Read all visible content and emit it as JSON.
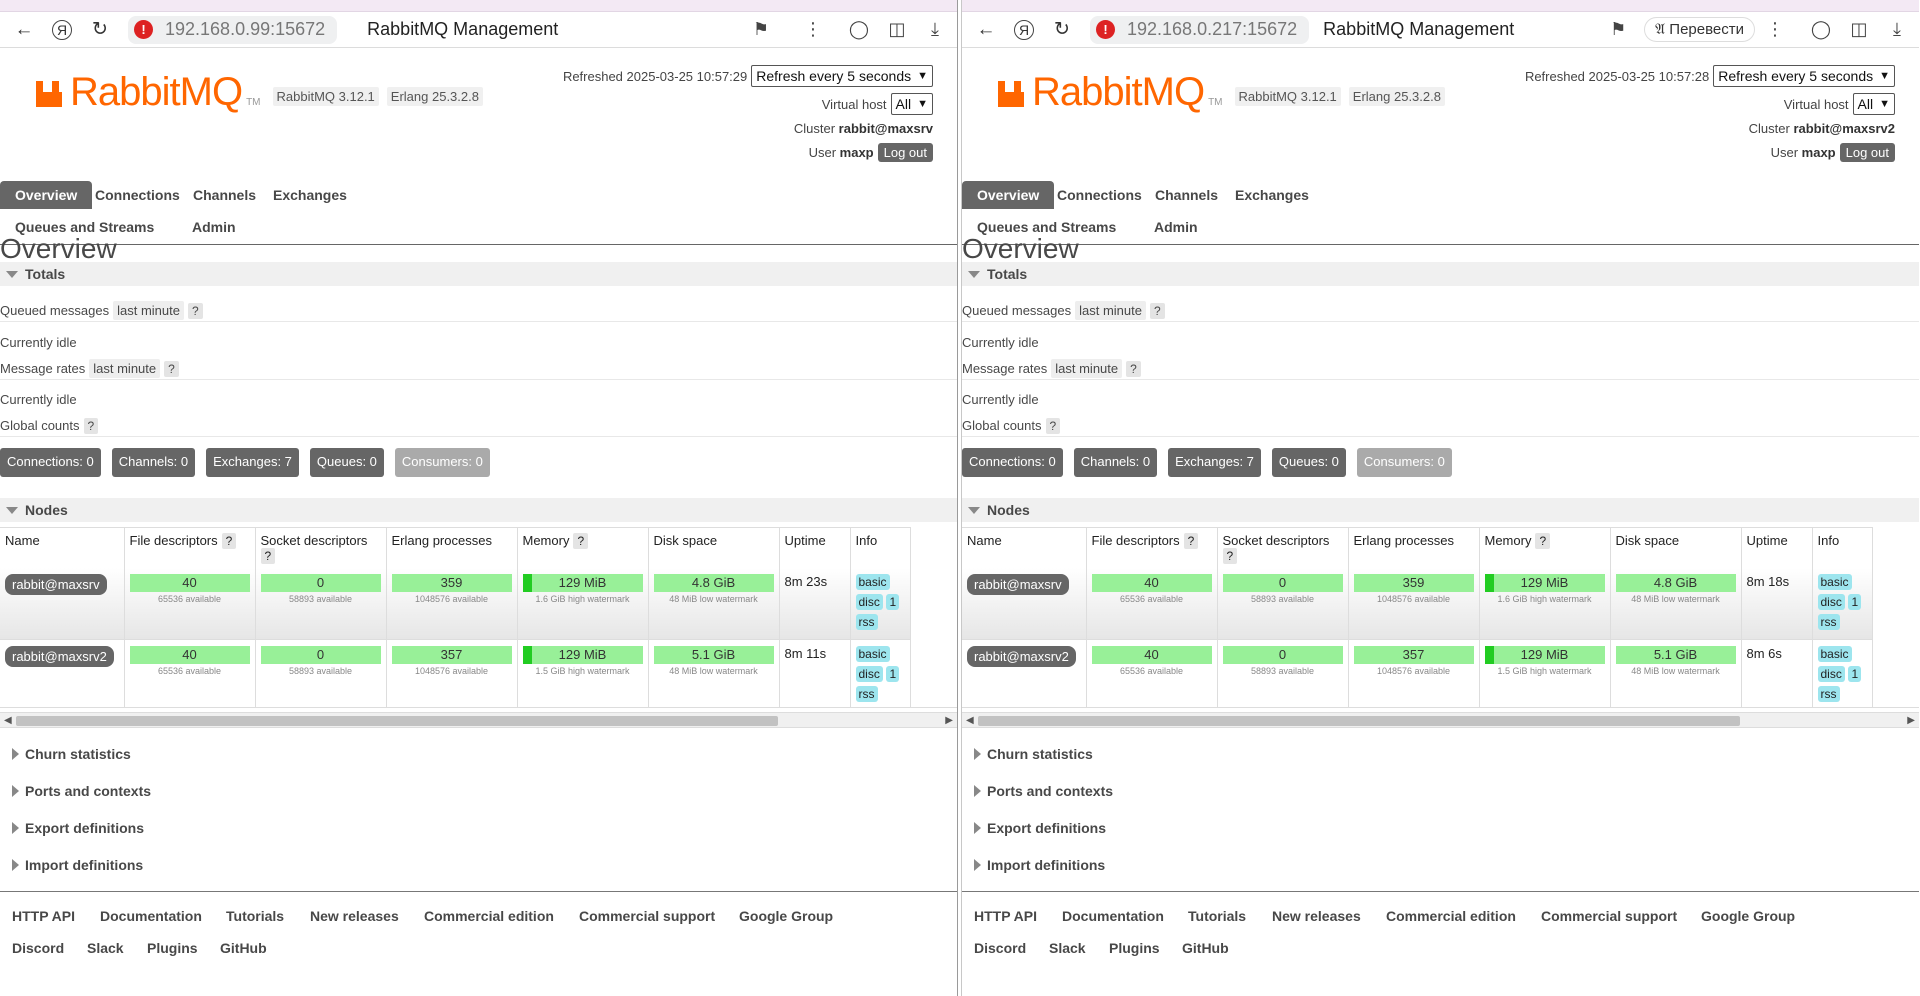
{
  "brand": {
    "wordmark": "RabbitMQ",
    "tm": "TM",
    "accent": "#ff6600"
  },
  "tabs": [
    "Overview",
    "Connections",
    "Channels",
    "Exchanges",
    "Queues and Streams",
    "Admin"
  ],
  "labels": {
    "virtual_host": "Virtual host",
    "cluster": "Cluster",
    "user": "User",
    "logout": "Log out",
    "overview_heading": "Overview",
    "totals": "Totals",
    "queued_messages": "Queued messages",
    "last_minute": "last minute",
    "help": "?",
    "currently_idle": "Currently idle",
    "message_rates": "Message rates",
    "global_counts": "Global counts",
    "nodes": "Nodes",
    "sections": [
      "Churn statistics",
      "Ports and contexts",
      "Export definitions",
      "Import definitions"
    ]
  },
  "columns": [
    "Name",
    "File descriptors",
    "Socket descriptors",
    "Erlang processes",
    "Memory",
    "Disk space",
    "Uptime",
    "Info"
  ],
  "info": [
    "basic",
    "disc",
    "1",
    "rss"
  ],
  "footer": [
    "HTTP API",
    "Documentation",
    "Tutorials",
    "New releases",
    "Commercial edition",
    "Commercial support",
    "Google Group",
    "Discord",
    "Slack",
    "Plugins",
    "GitHub"
  ],
  "left": {
    "url": "192.168.0.99:15672",
    "page_title": "RabbitMQ Management",
    "rabbitmq_version": "RabbitMQ 3.12.1",
    "erlang_version": "Erlang 25.3.2.8",
    "refreshed": "Refreshed 2025-03-25 10:57:29",
    "refresh_option": "Refresh every 5 seconds",
    "vhost_option": "All",
    "cluster": "rabbit@maxsrv",
    "user": "maxp",
    "counts": [
      "Connections: 0",
      "Channels: 0",
      "Exchanges: 7",
      "Queues: 0",
      "Consumers: 0"
    ],
    "nodes": [
      {
        "name": "rabbit@maxsrv",
        "fd": "40",
        "fd_sub": "65536 available",
        "sd": "0",
        "sd_sub": "58893 available",
        "ep": "359",
        "ep_sub": "1048576 available",
        "mem": "129 MiB",
        "mem_sub": "1.6 GiB high watermark",
        "disk": "4.8 GiB",
        "disk_sub": "48 MiB low watermark",
        "uptime": "8m 23s"
      },
      {
        "name": "rabbit@maxsrv2",
        "fd": "40",
        "fd_sub": "65536 available",
        "sd": "0",
        "sd_sub": "58893 available",
        "ep": "357",
        "ep_sub": "1048576 available",
        "mem": "129 MiB",
        "mem_sub": "1.5 GiB high watermark",
        "disk": "5.1 GiB",
        "disk_sub": "48 MiB low watermark",
        "uptime": "8m 11s"
      }
    ]
  },
  "right": {
    "url": "192.168.0.217:15672",
    "page_title": "RabbitMQ Management",
    "translate_label": "Перевести",
    "rabbitmq_version": "RabbitMQ 3.12.1",
    "erlang_version": "Erlang 25.3.2.8",
    "refreshed": "Refreshed 2025-03-25 10:57:28",
    "refresh_option": "Refresh every 5 seconds",
    "vhost_option": "All",
    "cluster": "rabbit@maxsrv2",
    "user": "maxp",
    "counts": [
      "Connections: 0",
      "Channels: 0",
      "Exchanges: 7",
      "Queues: 0",
      "Consumers: 0"
    ],
    "nodes": [
      {
        "name": "rabbit@maxsrv",
        "fd": "40",
        "fd_sub": "65536 available",
        "sd": "0",
        "sd_sub": "58893 available",
        "ep": "359",
        "ep_sub": "1048576 available",
        "mem": "129 MiB",
        "mem_sub": "1.6 GiB high watermark",
        "disk": "4.8 GiB",
        "disk_sub": "48 MiB low watermark",
        "uptime": "8m 18s"
      },
      {
        "name": "rabbit@maxsrv2",
        "fd": "40",
        "fd_sub": "65536 available",
        "sd": "0",
        "sd_sub": "58893 available",
        "ep": "357",
        "ep_sub": "1048576 available",
        "mem": "129 MiB",
        "mem_sub": "1.5 GiB high watermark",
        "disk": "5.1 GiB",
        "disk_sub": "48 MiB low watermark",
        "uptime": "8m 6s"
      }
    ]
  }
}
